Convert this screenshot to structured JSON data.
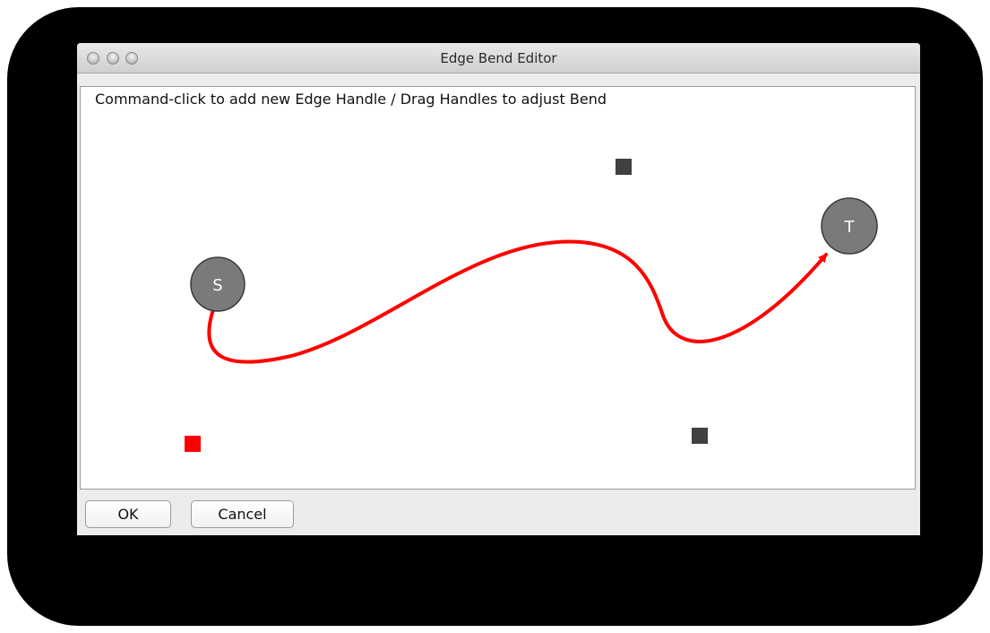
{
  "window": {
    "title": "Edge Bend Editor"
  },
  "panel": {
    "title": "Command-click to add new Edge Handle / Drag Handles to adjust Bend"
  },
  "nodes": {
    "source_label": "S",
    "target_label": "T"
  },
  "colors": {
    "edge": "#ff0000",
    "selected_handle": "#ff0000",
    "handle": "#404040",
    "node_fill": "#7a7a7a"
  },
  "buttons": {
    "ok_label": "OK",
    "cancel_label": "Cancel"
  }
}
